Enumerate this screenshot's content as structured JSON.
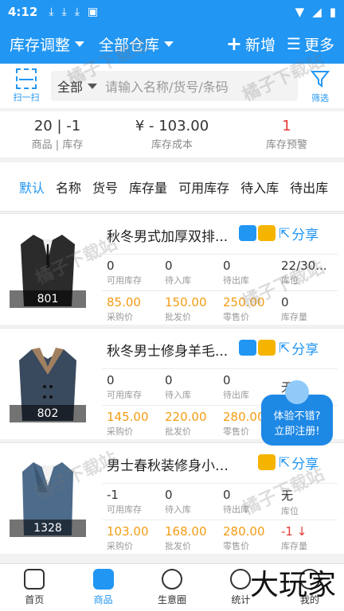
{
  "status": {
    "time": "4:12",
    "icons": [
      "download-icon",
      "download-icon",
      "download-icon",
      "app-icon"
    ],
    "right_icons": [
      "wifi-icon",
      "signal-icon",
      "battery-icon"
    ]
  },
  "appbar": {
    "adjust_label": "库存调整",
    "warehouse_label": "全部仓库",
    "add_label": "新增",
    "more_label": "更多"
  },
  "search": {
    "scan_label": "扫一扫",
    "scope_label": "全部",
    "placeholder": "请输入名称/货号/条码",
    "filter_label": "筛选"
  },
  "summary": {
    "count_value": "20 | -1",
    "count_label": "商品 | 库存",
    "cost_value": "¥ - 103.00",
    "cost_label": "库存成本",
    "alert_value": "1",
    "alert_label": "库存预警"
  },
  "sort_tabs": [
    "默认",
    "名称",
    "货号",
    "库存量",
    "可用库存",
    "待入库",
    "待出库"
  ],
  "items": [
    {
      "code": "801",
      "name": "秋冬男式加厚双排...",
      "share": "分享",
      "stock": [
        {
          "value": "0",
          "label": "可用库存"
        },
        {
          "value": "0",
          "label": "待入库"
        },
        {
          "value": "0",
          "label": "待出库"
        },
        {
          "value": "22/30...",
          "label": "库位"
        }
      ],
      "prices": [
        {
          "value": "85.00",
          "label": "采购价"
        },
        {
          "value": "150.00",
          "label": "批发价"
        },
        {
          "value": "250.00",
          "label": "零售价"
        },
        {
          "value": "0",
          "label": "库存量"
        }
      ]
    },
    {
      "code": "802",
      "name": "秋冬男士修身羊毛...",
      "share": "分享",
      "stock": [
        {
          "value": "0",
          "label": "可用库存"
        },
        {
          "value": "0",
          "label": "待入库"
        },
        {
          "value": "0",
          "label": "待出库"
        },
        {
          "value": "无",
          "label": ""
        }
      ],
      "prices": [
        {
          "value": "145.00",
          "label": "采购价"
        },
        {
          "value": "220.00",
          "label": "批发价"
        },
        {
          "value": "280.00",
          "label": "零售价"
        },
        {
          "value": "",
          "label": ""
        }
      ]
    },
    {
      "code": "1328",
      "name": "男士春秋装修身小拼...",
      "share": "分享",
      "stock": [
        {
          "value": "-1",
          "label": "可用库存"
        },
        {
          "value": "0",
          "label": "待入库"
        },
        {
          "value": "0",
          "label": "待出库"
        },
        {
          "value": "无",
          "label": "库位"
        }
      ],
      "prices": [
        {
          "value": "103.00",
          "label": "采购价"
        },
        {
          "value": "168.00",
          "label": "批发价"
        },
        {
          "value": "280.00",
          "label": "零售价"
        },
        {
          "value": "-1 ↓",
          "label": "库存量"
        }
      ]
    }
  ],
  "promo": {
    "line1": "体验不错?",
    "line2": "立即注册!"
  },
  "tabs": [
    "首页",
    "商品",
    "生意圈",
    "统计",
    "我的"
  ],
  "watermark": "橘子下载站",
  "brand": "大玩家",
  "colors": {
    "primary": "#2196f3",
    "price": "#f39c12",
    "alert": "#e53935"
  }
}
